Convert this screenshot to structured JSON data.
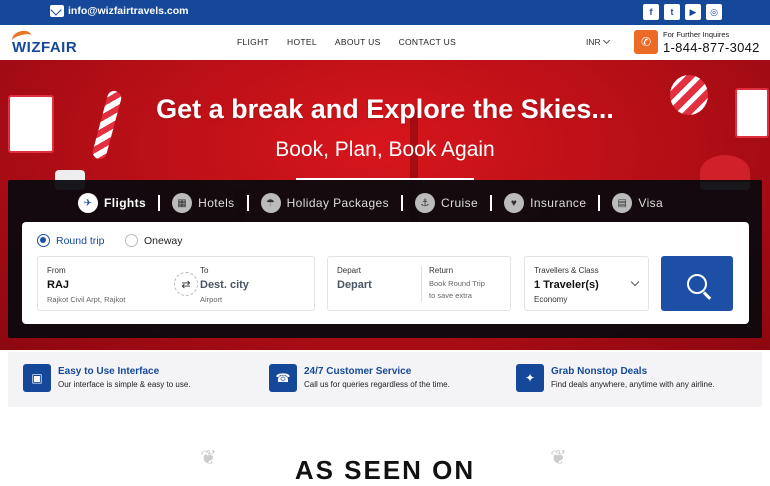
{
  "topbar": {
    "email": "info@wizfairtravels.com",
    "socials": [
      {
        "icon": "facebook-icon",
        "glyph": "f"
      },
      {
        "icon": "twitter-icon",
        "glyph": "t"
      },
      {
        "icon": "youtube-icon",
        "glyph": "▶"
      },
      {
        "icon": "instagram-icon",
        "glyph": "◎"
      }
    ]
  },
  "nav": {
    "logo": "WIZFAIR",
    "menu": [
      "FLIGHT",
      "HOTEL",
      "ABOUT US",
      "CONTACT US"
    ],
    "currency": "INR",
    "contact_label": "For Further Inquires",
    "phone": "1-844-877-3042"
  },
  "hero": {
    "title": "Get a break and Explore the Skies...",
    "subtitle": "Book, Plan, Book Again"
  },
  "tabs": [
    {
      "label": "Flights",
      "icon": "plane-icon",
      "glyph": "✈",
      "active": true
    },
    {
      "label": "Hotels",
      "icon": "hotel-icon",
      "glyph": "▦",
      "active": false
    },
    {
      "label": "Holiday Packages",
      "icon": "beach-icon",
      "glyph": "☂",
      "active": false
    },
    {
      "label": "Cruise",
      "icon": "cruise-icon",
      "glyph": "⚓",
      "active": false
    },
    {
      "label": "Insurance",
      "icon": "insurance-icon",
      "glyph": "♥",
      "active": false
    },
    {
      "label": "Visa",
      "icon": "visa-icon",
      "glyph": "▤",
      "active": false
    }
  ],
  "search": {
    "trip_types": [
      {
        "label": "Round trip",
        "selected": true
      },
      {
        "label": "Oneway",
        "selected": false
      }
    ],
    "from": {
      "label": "From",
      "value": "RAJ",
      "detail": "Rajkot Civil Arpt, Rajkot"
    },
    "to": {
      "label": "To",
      "value": "Dest. city",
      "detail": "Airport"
    },
    "depart": {
      "label": "Depart",
      "value": "Depart"
    },
    "return": {
      "label": "Return",
      "hint_line1": "Book Round Trip",
      "hint_line2": "to save extra"
    },
    "travellers": {
      "label": "Travellers & Class",
      "value": "1 Traveler(s)",
      "class": "Economy"
    },
    "swap_glyph": "⇄"
  },
  "features": [
    {
      "icon": "interface-icon",
      "glyph": "▣",
      "title": "Easy to Use Interface",
      "desc": "Our interface is simple & easy to use."
    },
    {
      "icon": "support-icon",
      "glyph": "☎",
      "title": "24/7 Customer Service",
      "desc": "Call us for queries regardless of the time."
    },
    {
      "icon": "deals-icon",
      "glyph": "✦",
      "title": "Grab Nonstop Deals",
      "desc": "Find deals anywhere, anytime with any airline."
    }
  ],
  "seen_on": "AS SEEN ON",
  "colors": {
    "brand_blue": "#16489a",
    "accent_orange": "#ec6a26",
    "hero_red": "#c8121a"
  }
}
